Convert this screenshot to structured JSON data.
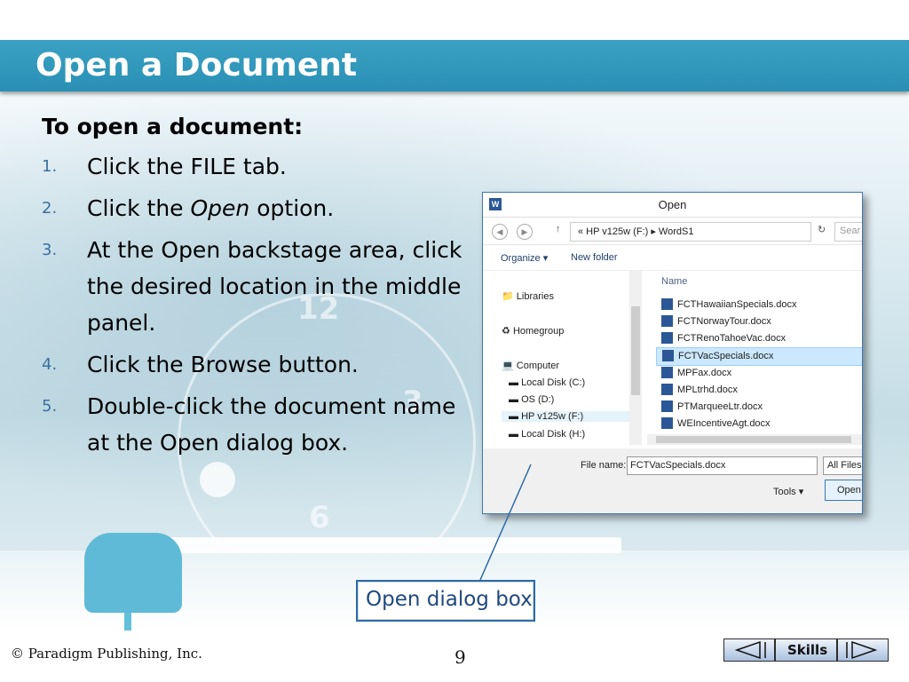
{
  "slide": {
    "title": "Open a Document",
    "lead": "To open a document:",
    "steps": [
      {
        "num": "1.",
        "text": "Click the FILE tab."
      },
      {
        "num": "2.",
        "pre": "Click the ",
        "em": "Open",
        "post": " option."
      },
      {
        "num": "3.",
        "text": "At the Open backstage area, click the desired location in the middle panel."
      },
      {
        "num": "4.",
        "text": "Click the Browse button."
      },
      {
        "num": "5.",
        "text": "Double-click the document name at the Open dialog box."
      }
    ],
    "callout": "Open dialog box",
    "copyright": "© Paradigm Publishing, Inc.",
    "page_number": "9",
    "nav": {
      "skills_label": "Skills"
    }
  },
  "dialog": {
    "title": "Open",
    "address": "« HP v125w (F:) ▸ WordS1",
    "search_placeholder": "Sear",
    "organize": "Organize ▾",
    "new_folder": "New folder",
    "column_header": "Name",
    "nav_items": [
      {
        "label": "Libraries",
        "icon": "libraries-icon"
      },
      {
        "label": "Homegroup",
        "icon": "homegroup-icon"
      },
      {
        "label": "Computer",
        "icon": "computer-icon"
      },
      {
        "label": "Local Disk (C:)",
        "icon": "drive-icon"
      },
      {
        "label": "OS (D:)",
        "icon": "drive-icon"
      },
      {
        "label": "HP v125w (F:)",
        "icon": "drive-icon",
        "selected": true
      },
      {
        "label": "Local Disk (H:)",
        "icon": "drive-icon"
      }
    ],
    "files": [
      {
        "name": "FCTHawaiianSpecials.docx"
      },
      {
        "name": "FCTNorwayTour.docx"
      },
      {
        "name": "FCTRenoTahoeVac.docx"
      },
      {
        "name": "FCTVacSpecials.docx",
        "selected": true
      },
      {
        "name": "MPFax.docx"
      },
      {
        "name": "MPLtrhd.docx"
      },
      {
        "name": "PTMarqueeLtr.docx"
      },
      {
        "name": "WEIncentiveAgt.docx"
      }
    ],
    "file_name_label": "File name:",
    "file_name_value": "FCTVacSpecials.docx",
    "file_type": "All Files",
    "tools": "Tools ▾",
    "open_button": "Open"
  },
  "colors": {
    "title_bar": "#2f95ba",
    "step_number": "#3b6fa0",
    "callout_border": "#2d6aa6"
  }
}
